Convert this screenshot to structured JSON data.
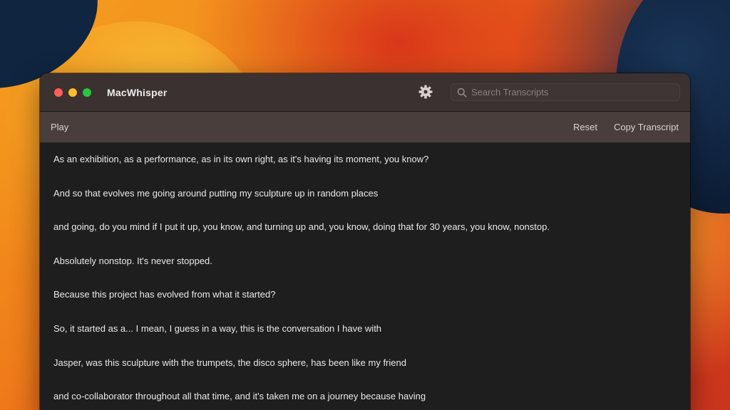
{
  "window": {
    "title": "MacWhisper"
  },
  "search": {
    "placeholder": "Search Transcripts",
    "value": ""
  },
  "toolbar": {
    "play_label": "Play",
    "reset_label": "Reset",
    "copy_label": "Copy Transcript"
  },
  "transcript": {
    "lines": [
      "As an exhibition, as a performance, as in its own right, as it's having its moment, you know?",
      "And so that evolves me going around putting my sculpture up in random places",
      "and going, do you mind if I put it up, you know, and turning up and, you know, doing that for 30 years, you know, nonstop.",
      "Absolutely nonstop. It's never stopped.",
      "Because this project has evolved from what it started?",
      "So, it started as a... I mean, I guess in a way, this is the conversation I have with",
      "Jasper, was this sculpture with the trumpets, the disco sphere, has been like my friend",
      "and co-collaborator throughout all that time, and it's taken me on a journey because having"
    ]
  },
  "colors": {
    "close": "#ff5f57",
    "minimize": "#febc2e",
    "maximize": "#28c840"
  }
}
